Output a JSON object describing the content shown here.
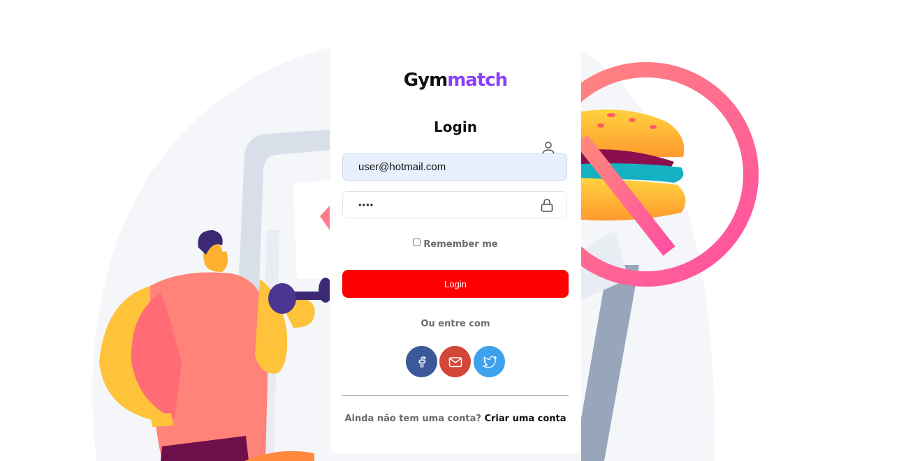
{
  "brand": {
    "part1": "Gym",
    "part2": "match"
  },
  "login": {
    "title": "Login",
    "email_value": "user@hotmail.com",
    "password_value": "••••",
    "remember_label": "Remember me",
    "submit_label": "Login"
  },
  "social": {
    "label": "Ou entre com",
    "buttons": [
      {
        "name": "facebook",
        "icon": "facebook-icon",
        "color": "#3b5998"
      },
      {
        "name": "gmail",
        "icon": "mail-icon",
        "color": "#d44638"
      },
      {
        "name": "twitter",
        "icon": "twitter-icon",
        "color": "#3ea1ec"
      }
    ]
  },
  "signup": {
    "prompt": "Ainda não tem uma conta?",
    "link_label": "Criar uma conta"
  },
  "colors": {
    "accent": "#8a3ffc",
    "login_button": "#ff0000"
  }
}
